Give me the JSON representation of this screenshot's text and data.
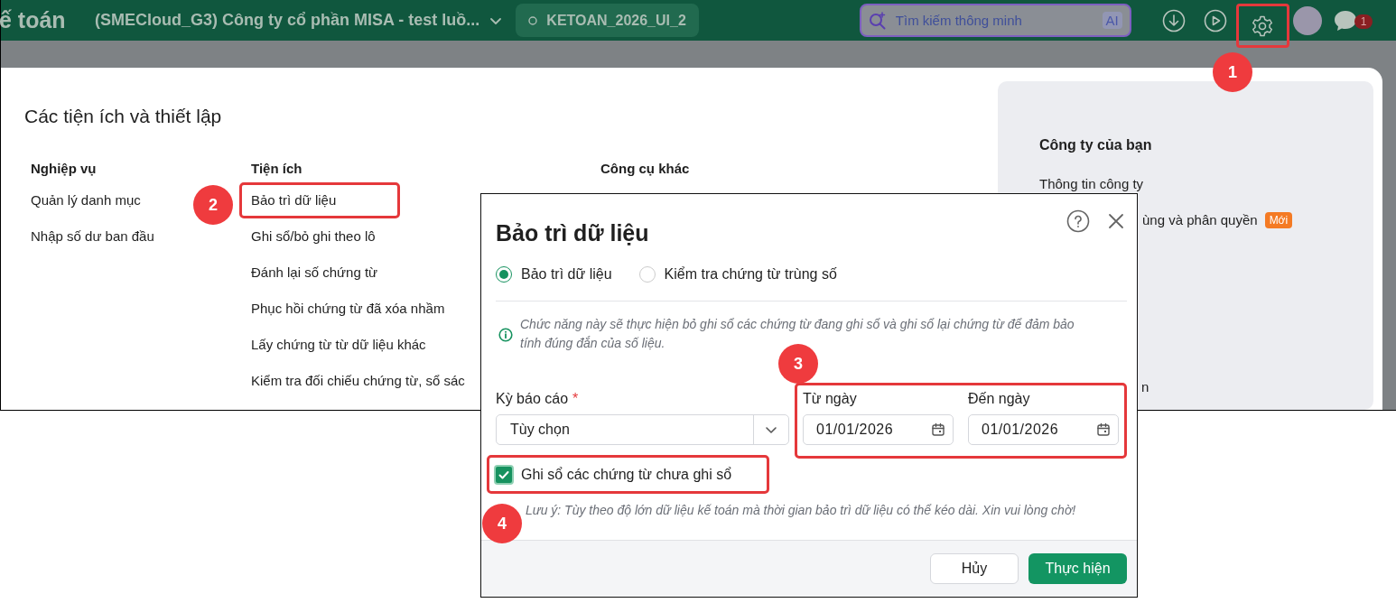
{
  "header": {
    "app_title": "ế toán",
    "company": "(SMECloud_G3) Công ty cổ phần MISA - test luồ...",
    "database": "KETOAN_2026_UI_2",
    "search": {
      "placeholder": "Tìm kiếm thông minh",
      "badge": "AI"
    },
    "notification_count": "1",
    "settings_highlighted": true
  },
  "settings_panel": {
    "title": "Các tiện ích và thiết lập",
    "columns": [
      {
        "heading": "Nghiệp vụ",
        "items": [
          {
            "label": "Quản lý danh mục",
            "highlighted": false
          },
          {
            "label": "Nhập số dư ban đầu",
            "highlighted": false
          }
        ]
      },
      {
        "heading": "Tiện ích",
        "items": [
          {
            "label": "Bảo trì dữ liệu",
            "highlighted": true
          },
          {
            "label": "Ghi sổ/bỏ ghi theo lô",
            "highlighted": false
          },
          {
            "label": "Đánh lại số chứng từ",
            "highlighted": false
          },
          {
            "label": "Phục hồi chứng từ đã xóa nhầm",
            "highlighted": false
          },
          {
            "label": "Lấy chứng từ từ dữ liệu khác",
            "highlighted": false
          },
          {
            "label": "Kiểm tra đối chiếu chứng từ, sổ sác",
            "highlighted": false
          }
        ]
      },
      {
        "heading": "Công cụ khác"
      }
    ]
  },
  "company_panel": {
    "heading": "Công ty của bạn",
    "items": [
      {
        "label": "Thông tin công ty"
      },
      {
        "label": "ùng và phân quyền",
        "badge": "Mới"
      },
      {
        "label": "n"
      }
    ]
  },
  "dialog": {
    "title": "Bảo trì dữ liệu",
    "modes": [
      {
        "label": "Bảo trì dữ liệu",
        "selected": true
      },
      {
        "label": "Kiểm tra chứng từ trùng số",
        "selected": false
      }
    ],
    "info": "Chức năng này sẽ thực hiện bỏ ghi sổ các chứng từ đang ghi sổ và ghi sổ lại chứng từ để đảm bảo tính đúng đắn của số liệu.",
    "period": {
      "label": "Kỳ báo cáo",
      "required_mark": "*",
      "value": "Tùy chọn"
    },
    "dates_highlighted": true,
    "dates": [
      {
        "label": "Từ ngày",
        "value": "01/01/2026"
      },
      {
        "label": "Đến ngày",
        "value": "01/01/2026"
      }
    ],
    "post_unposted": {
      "label": "Ghi sổ các chứng từ chưa ghi sổ",
      "checked": true,
      "highlighted": true
    },
    "note": "Lưu ý: Tùy theo độ lớn dữ liệu kế toán mà thời gian bảo trì dữ liệu có thể kéo dài. Xin vui lòng chờ!",
    "buttons": [
      {
        "label": "Hủy",
        "kind": "secondary"
      },
      {
        "label": "Thực hiện",
        "kind": "primary"
      }
    ]
  },
  "callouts": [
    "1",
    "2",
    "3",
    "4"
  ]
}
